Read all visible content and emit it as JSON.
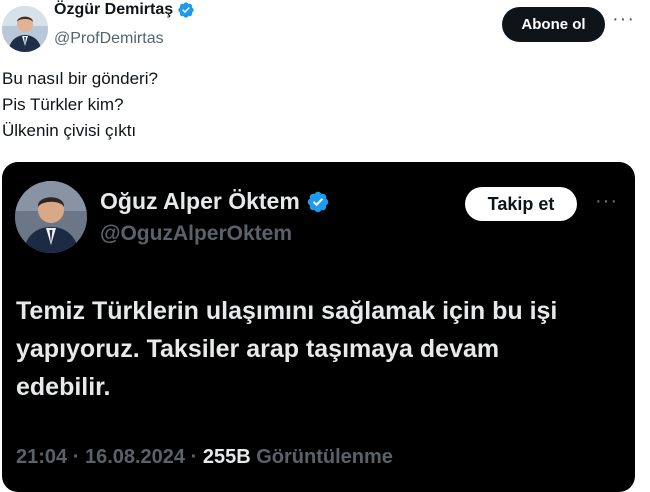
{
  "author": {
    "name": "Özgür Demirtaş",
    "handle": "@ProfDemirtas",
    "follow_label": "Abone ol",
    "more_label": "···"
  },
  "post": {
    "lines": [
      "Bu nasıl bir gönderi?",
      "Pis Türkler kim?",
      "Ülkenin çivisi çıktı"
    ]
  },
  "embedded_post": {
    "name": "Oğuz Alper Öktem",
    "handle": "@OguzAlperOktem",
    "follow_label": "Takip et",
    "more_label": "···",
    "lines": [
      "Temiz Türklerin ulaşımını sağlamak için bu işi",
      "yapıyoruz. Taksiler arap taşımaya devam",
      "edebilir."
    ],
    "time": "21:04",
    "separator": "·",
    "date": "16.08.2024",
    "views_count": "255B",
    "views_label": "Görüntülenme"
  },
  "colors": {
    "verified_badge": "#1d9bf0",
    "follow_button_bg": "#0f1419",
    "card_bg": "#000000"
  },
  "icons": [
    "verified-badge-icon",
    "more-icon"
  ]
}
